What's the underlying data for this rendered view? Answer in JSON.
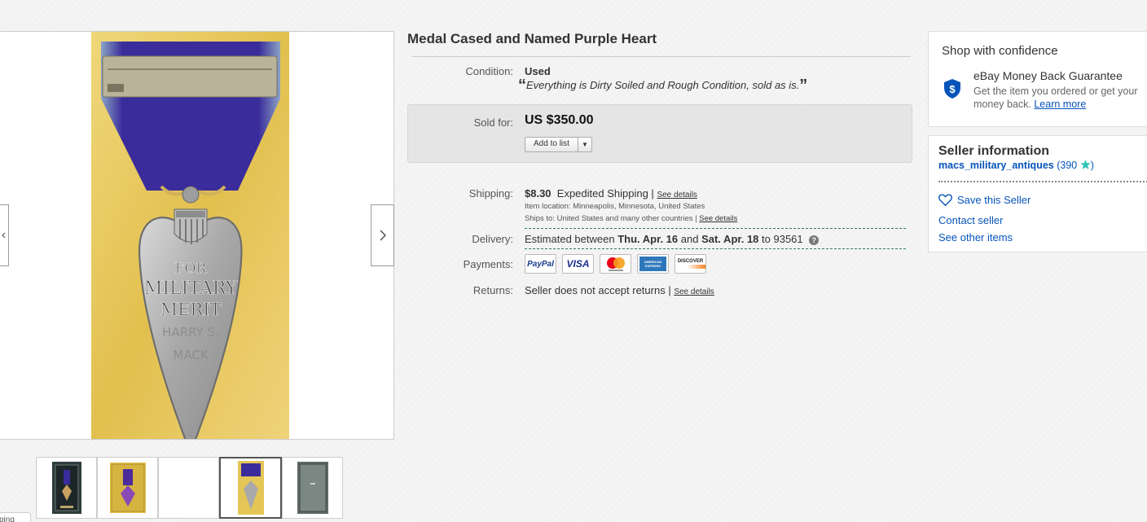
{
  "item": {
    "title": "Medal Cased and Named Purple Heart",
    "condition_label": "Condition:",
    "condition_value": "Used",
    "condition_open_quote": "“",
    "condition_desc": "Everything is Dirty Soiled and Rough Condition, sold as is.",
    "condition_close_quote": "”",
    "sold_label": "Sold for:",
    "price": "US $350.00",
    "add_to_list": "Add to list"
  },
  "shipping": {
    "label": "Shipping:",
    "cost": "$8.30",
    "method": "Expedited Shipping |",
    "details_link": "See details",
    "location": "Item location:  Minneapolis, Minnesota, United States",
    "ships_to": "Ships to:  United States and many other countries |",
    "ships_to_link": "See details"
  },
  "delivery": {
    "label": "Delivery:",
    "prefix": "Estimated between",
    "start": "Thu. Apr. 16",
    "and": "and",
    "end": "Sat. Apr. 18",
    "to": "to 93561"
  },
  "payments": {
    "label": "Payments:",
    "methods": [
      "PayPal",
      "VISA",
      "MasterCard",
      "American Express",
      "DISCOVER"
    ],
    "paypal": "PayPal",
    "visa": "VISA",
    "amex": "AMERICAN EXPRESS",
    "discover": "DISCOVER"
  },
  "returns": {
    "label": "Returns:",
    "text": "Seller does not accept returns |",
    "link": "See details"
  },
  "confidence": {
    "title": "Shop with confidence",
    "guarantee_title": "eBay Money Back Guarantee",
    "guarantee_desc": "Get the item you ordered or get your money back.",
    "learn_more": "Learn more"
  },
  "seller": {
    "title": "Seller information",
    "name": "macs_military_antiques",
    "feedback_open": "(390",
    "feedback_close": ")",
    "save_seller": "Save this Seller",
    "contact": "Contact seller",
    "other_items": "See other items"
  },
  "medal_image": {
    "line1": "FOR",
    "line2": "MILITARY",
    "line3": "MERIT",
    "name1": "HARRY S.",
    "name2": "MACK"
  },
  "bottom_tab": "ping",
  "colors": {
    "link_blue": "#0654ba",
    "star_teal": "#2ec4b6",
    "dash_green": "#2f7d61",
    "ribbon_purple": "#3a2c9a",
    "cloth_yellow": "#e8c95a"
  }
}
